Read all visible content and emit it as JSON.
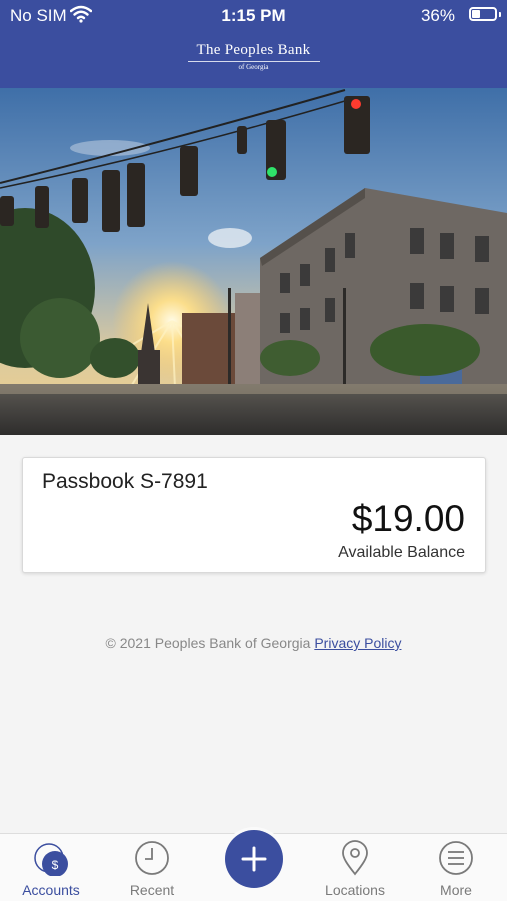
{
  "status_bar": {
    "carrier": "No SIM",
    "time": "1:15 PM",
    "battery_percent": "36%",
    "battery_level": 0.36
  },
  "header": {
    "logo_title": "The Peoples Bank",
    "logo_subtitle": "of Georgia"
  },
  "account": {
    "name": "Passbook S-7891",
    "balance": "$19.00",
    "balance_label": "Available Balance"
  },
  "footer": {
    "copyright": "© 2021 Peoples Bank of Georgia",
    "privacy_link": "Privacy Policy"
  },
  "tabbar": {
    "accent_color": "#3b4e9f",
    "items": [
      {
        "label": "Accounts",
        "icon": "dollar-icon",
        "active": true
      },
      {
        "label": "Recent",
        "icon": "clock-icon"
      },
      {
        "label": "",
        "icon": "plus-icon"
      },
      {
        "label": "Locations",
        "icon": "map-pin-icon"
      },
      {
        "label": "More",
        "icon": "menu-icon"
      }
    ]
  }
}
